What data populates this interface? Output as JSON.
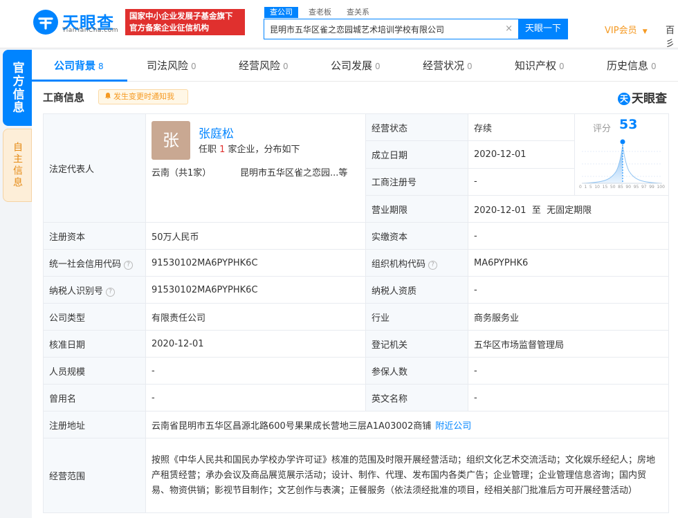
{
  "header": {
    "logo_text": "天眼查",
    "logo_sub": "TianYanCha.com",
    "banner_line1": "国家中小企业发展子基金旗下",
    "banner_line2": "官方备案企业征信机构",
    "search_tabs": [
      "查公司",
      "查老板",
      "查关系"
    ],
    "search_value": "昆明市五华区雀之恋园城艺术培训学校有限公司",
    "search_clear": "×",
    "search_button": "天眼一下",
    "vip_label": "VIP会员",
    "vip_caret": "▼",
    "more_label": "百彡"
  },
  "side_tabs": [
    "官方信息",
    "自主信息"
  ],
  "nav": {
    "items": [
      {
        "label": "公司背景",
        "count": "8"
      },
      {
        "label": "司法风险",
        "count": "0"
      },
      {
        "label": "经营风险",
        "count": "0"
      },
      {
        "label": "公司发展",
        "count": "0"
      },
      {
        "label": "经营状况",
        "count": "0"
      },
      {
        "label": "知识产权",
        "count": "0"
      },
      {
        "label": "历史信息",
        "count": "0"
      }
    ]
  },
  "section": {
    "title": "工商信息",
    "notify": "发生变更时通知我",
    "brand": "天眼查",
    "brand_mark": "天"
  },
  "legal": {
    "label": "法定代表人",
    "avatar": "张",
    "name": "张庭松",
    "post_prefix": "任职 ",
    "post_count": "1",
    "post_suffix": " 家企业，分布如下",
    "region": "云南（共1家）",
    "company": "昆明市五华区雀之恋园...等"
  },
  "score": {
    "label": "评分",
    "value": "53",
    "axis": [
      "0",
      "1",
      "5",
      "10",
      "15",
      "50",
      "85",
      "90",
      "95",
      "97",
      "99",
      "100"
    ]
  },
  "icons": {
    "help": "?",
    "bell": "bell-icon"
  },
  "right_top": [
    {
      "label": "经营状态",
      "value": "存续"
    },
    {
      "label": "成立日期",
      "value": "2020-12-01"
    },
    {
      "label": "工商注册号",
      "value": "-"
    },
    {
      "label": "营业期限",
      "value": "2020-12-01  至  无固定期限"
    }
  ],
  "rows": [
    {
      "l1": "注册资本",
      "v1": "50万人民币",
      "l2": "实缴资本",
      "v2": "-"
    },
    {
      "l1": "统一社会信用代码",
      "v1": "91530102MA6PYPHK6C",
      "l2": "组织机构代码",
      "v2": "MA6PYPHK6"
    },
    {
      "l1": "纳税人识别号",
      "v1": "91530102MA6PYPHK6C",
      "l2": "纳税人资质",
      "v2": "-"
    },
    {
      "l1": "公司类型",
      "v1": "有限责任公司",
      "l2": "行业",
      "v2": "商务服务业"
    },
    {
      "l1": "核准日期",
      "v1": "2020-12-01",
      "l2": "登记机关",
      "v2": "五华区市场监督管理局"
    },
    {
      "l1": "人员规模",
      "v1": "-",
      "l2": "参保人数",
      "v2": "-"
    },
    {
      "l1": "曾用名",
      "v1": "-",
      "l2": "英文名称",
      "v2": "-"
    }
  ],
  "address": {
    "label": "注册地址",
    "value": "云南省昆明市五华区昌源北路600号果果成长营地三层A1A03002商铺",
    "link": "附近公司"
  },
  "scope": {
    "label": "经营范围",
    "value": "按照《中华人民共和国民办学校办学许可证》核准的范围及时限开展经营活动；组织文化艺术交流活动；文化娱乐经纪人；房地产租赁经营；承办会议及商品展览展示活动；设计、制作、代理、发布国内各类广告；企业管理；企业管理信息咨询；国内贸易、物资供销；影视节目制作；文艺创作与表演；正餐服务（依法须经批准的项目，经相关部门批准后方可开展经营活动）"
  }
}
